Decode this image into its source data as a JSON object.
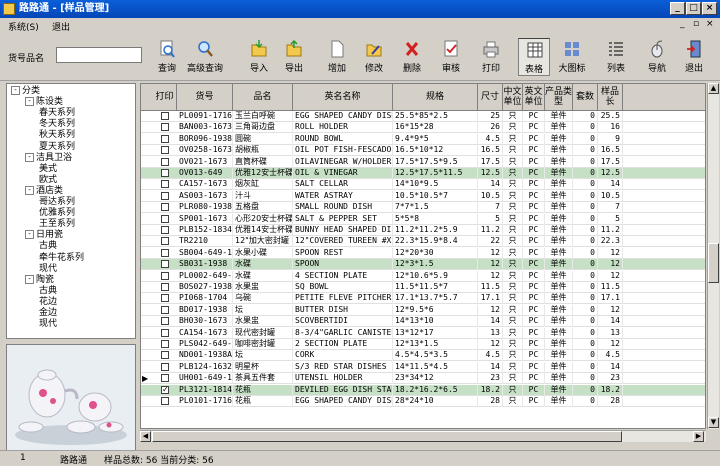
{
  "window": {
    "title": "路路通 - [样品管理]"
  },
  "menu": {
    "system": "系统(S)",
    "exit": "退出"
  },
  "search": {
    "label": "货号品名",
    "value": ""
  },
  "toolbar": [
    {
      "name": "query",
      "label": "查询",
      "icon": "search-icon"
    },
    {
      "name": "advanced-query",
      "label": "高级查询",
      "icon": "magnifier-icon"
    },
    {
      "name": "import",
      "label": "导入",
      "icon": "folder-in-icon"
    },
    {
      "name": "export",
      "label": "导出",
      "icon": "folder-out-icon"
    },
    {
      "name": "add",
      "label": "增加",
      "icon": "new-doc-icon"
    },
    {
      "name": "edit",
      "label": "修改",
      "icon": "folder-edit-icon"
    },
    {
      "name": "delete",
      "label": "删除",
      "icon": "x-icon"
    },
    {
      "name": "review",
      "label": "审核",
      "icon": "check-doc-icon"
    },
    {
      "name": "print",
      "label": "打印",
      "icon": "printer-icon"
    },
    {
      "name": "table",
      "label": "表格",
      "icon": "table-icon"
    },
    {
      "name": "large-icons",
      "label": "大图标",
      "icon": "large-icons-icon"
    },
    {
      "name": "list",
      "label": "列表",
      "icon": "list-icon"
    },
    {
      "name": "navigate",
      "label": "导航",
      "icon": "mouse-icon"
    },
    {
      "name": "exit",
      "label": "退出",
      "icon": "exit-door-icon"
    }
  ],
  "tree": [
    {
      "label": "分类",
      "level": 0,
      "box": "-"
    },
    {
      "label": "陈设类",
      "level": 1,
      "box": "-"
    },
    {
      "label": "春天系列",
      "level": 2
    },
    {
      "label": "冬天系列",
      "level": 2
    },
    {
      "label": "秋天系列",
      "level": 2
    },
    {
      "label": "夏天系列",
      "level": 2
    },
    {
      "label": "洁具卫浴",
      "level": 1,
      "box": "-"
    },
    {
      "label": "美式",
      "level": 2
    },
    {
      "label": "欧式",
      "level": 2
    },
    {
      "label": "酒店类",
      "level": 1,
      "box": "-"
    },
    {
      "label": "哥达系列",
      "level": 2
    },
    {
      "label": "优雅系列",
      "level": 2
    },
    {
      "label": "王至系列",
      "level": 2
    },
    {
      "label": "日用瓷",
      "level": 1,
      "box": "-"
    },
    {
      "label": "古典",
      "level": 2
    },
    {
      "label": "牵牛花系列",
      "level": 2
    },
    {
      "label": "现代",
      "level": 2
    },
    {
      "label": "陶瓷",
      "level": 1,
      "box": "-"
    },
    {
      "label": "古典",
      "level": 2
    },
    {
      "label": "花边",
      "level": 2
    },
    {
      "label": "金边",
      "level": 2
    },
    {
      "label": "现代",
      "level": 2
    }
  ],
  "columns": [
    "打印",
    "货号",
    "品名",
    "英名名称",
    "规格",
    "尺寸",
    "中文单位",
    "英文单位",
    "产品类型",
    "套数",
    "样品长"
  ],
  "rows": [
    {
      "print": false,
      "code": "PL0091-1716B",
      "name": "玉兰白呼碗",
      "en": "EGG SHAPED CANDY DISH-M",
      "spec": "25.5*85*2.5",
      "size": "25",
      "cu": "只",
      "eu": "PC",
      "type": "单件",
      "sets": "0",
      "len": "25.5",
      "hl": false
    },
    {
      "print": false,
      "code": "BAN003-1673",
      "name": "三角哥边盘",
      "en": "ROLL HOLDER",
      "spec": "16*15*28",
      "size": "26",
      "cu": "只",
      "eu": "PC",
      "type": "单件",
      "sets": "0",
      "len": "16",
      "hl": false
    },
    {
      "print": false,
      "code": "BOR096-1938",
      "name": "圆碗",
      "en": "ROUND BOWL",
      "spec": "9.4*9*5",
      "size": "4.5",
      "cu": "只",
      "eu": "PC",
      "type": "单件",
      "sets": "0",
      "len": "9",
      "hl": false
    },
    {
      "print": false,
      "code": "OV0258-1673",
      "name": "胡椒瓶",
      "en": "OIL POT FISH-FESCADO",
      "spec": "16.5*10*12",
      "size": "16.5",
      "cu": "只",
      "eu": "PC",
      "type": "单件",
      "sets": "0",
      "len": "16.5",
      "hl": false
    },
    {
      "print": false,
      "code": "OV021-1673",
      "name": "直筒杯碟",
      "en": "OILAVINEGAR W/HOLDER",
      "spec": "17.5*17.5*9.5",
      "size": "17.5",
      "cu": "只",
      "eu": "PC",
      "type": "单件",
      "sets": "0",
      "len": "17.5",
      "hl": false
    },
    {
      "print": false,
      "code": "OV013-649",
      "name": "优雅12安士杯碟",
      "en": "OIL & VINEGAR",
      "spec": "12.5*17.5*11.5",
      "size": "12.5",
      "cu": "只",
      "eu": "PC",
      "type": "单件",
      "sets": "0",
      "len": "12.5",
      "hl": true
    },
    {
      "print": false,
      "code": "CA157-1673",
      "name": "烟灰缸",
      "en": "SALT CELLAR",
      "spec": "14*10*9.5",
      "size": "14",
      "cu": "只",
      "eu": "PC",
      "type": "单件",
      "sets": "0",
      "len": "14",
      "hl": false
    },
    {
      "print": false,
      "code": "AS003-1673",
      "name": "汁斗",
      "en": "WATER ASTRAY",
      "spec": "10.5*10.5*7",
      "size": "10.5",
      "cu": "只",
      "eu": "PC",
      "type": "单件",
      "sets": "0",
      "len": "10.5",
      "hl": false
    },
    {
      "print": false,
      "code": "PLR080-1938D",
      "name": "五格盘",
      "en": "SMALL ROUND DISH",
      "spec": "7*7*1.5",
      "size": "7",
      "cu": "只",
      "eu": "PC",
      "type": "单件",
      "sets": "0",
      "len": "7",
      "hl": false
    },
    {
      "print": false,
      "code": "SP001-1673",
      "name": "心形20安士杯碟",
      "en": "SALT & PEPPER SET",
      "spec": "5*5*8",
      "size": "5",
      "cu": "只",
      "eu": "PC",
      "type": "单件",
      "sets": "0",
      "len": "5",
      "hl": false
    },
    {
      "print": false,
      "code": "PLB152-1834",
      "name": "优雅14安士杯碟",
      "en": "BUNNY HEAD SHAPED DISH",
      "spec": "11.2*11.2*5.9",
      "size": "11.2",
      "cu": "只",
      "eu": "PC",
      "type": "单件",
      "sets": "0",
      "len": "11.2",
      "hl": false
    },
    {
      "print": false,
      "code": "TR2210",
      "name": "12\"加大密封罐",
      "en": "12\"COVERED TUREEN #XL",
      "spec": "22.3*15.9*8.4",
      "size": "22",
      "cu": "只",
      "eu": "PC",
      "type": "单件",
      "sets": "0",
      "len": "22.3",
      "hl": false
    },
    {
      "print": false,
      "code": "SB004-649-1",
      "name": "水果小碟",
      "en": "SPOON REST",
      "spec": "12*20*30",
      "size": "12",
      "cu": "只",
      "eu": "PC",
      "type": "单件",
      "sets": "0",
      "len": "12",
      "hl": false
    },
    {
      "print": false,
      "code": "SB031-1938",
      "name": "水碟",
      "en": "SPOON",
      "spec": "12*3*1.5",
      "size": "12",
      "cu": "只",
      "eu": "PC",
      "type": "单件",
      "sets": "0",
      "len": "12",
      "hl": true
    },
    {
      "print": false,
      "code": "PL0002-649-1",
      "name": "水碟",
      "en": "4 SECTION PLATE",
      "spec": "12*10.6*5.9",
      "size": "12",
      "cu": "只",
      "eu": "PC",
      "type": "单件",
      "sets": "0",
      "len": "12",
      "hl": false
    },
    {
      "print": false,
      "code": "BOS027-1938A",
      "name": "水果盅",
      "en": "SQ BOWL",
      "spec": "11.5*11.5*7",
      "size": "11.5",
      "cu": "只",
      "eu": "PC",
      "type": "单件",
      "sets": "0",
      "len": "11.5",
      "hl": false
    },
    {
      "print": false,
      "code": "PI068-1704",
      "name": "乌碗",
      "en": "PETITE FLEVE PITCHER",
      "spec": "17.1*13.7*5.7",
      "size": "17.1",
      "cu": "只",
      "eu": "PC",
      "type": "单件",
      "sets": "0",
      "len": "17.1",
      "hl": false
    },
    {
      "print": false,
      "code": "BD017-1938",
      "name": "坛",
      "en": "BUTTER DISH",
      "spec": "12*9.5*6",
      "size": "12",
      "cu": "只",
      "eu": "PC",
      "type": "单件",
      "sets": "0",
      "len": "12",
      "hl": false
    },
    {
      "print": false,
      "code": "BH030-1673",
      "name": "水果盅",
      "en": "SCOVBERTIDI",
      "spec": "14*13*10",
      "size": "14",
      "cu": "只",
      "eu": "PC",
      "type": "单件",
      "sets": "0",
      "len": "14",
      "hl": false
    },
    {
      "print": false,
      "code": "CA154-1673",
      "name": "现代密封罐",
      "en": "8-3/4\"GARLIC CANISTER",
      "spec": "13*12*17",
      "size": "13",
      "cu": "只",
      "eu": "PC",
      "type": "单件",
      "sets": "0",
      "len": "13",
      "hl": false
    },
    {
      "print": false,
      "code": "PLS042-649-1",
      "name": "咖啡密封罐",
      "en": "2 SECTION PLATE",
      "spec": "12*13*1.5",
      "size": "12",
      "cu": "只",
      "eu": "PC",
      "type": "单件",
      "sets": "0",
      "len": "12",
      "hl": false
    },
    {
      "print": false,
      "code": "ND001-1938A",
      "name": "坛",
      "en": "CORK",
      "spec": "4.5*4.5*3.5",
      "size": "4.5",
      "cu": "只",
      "eu": "PC",
      "type": "单件",
      "sets": "0",
      "len": "4.5",
      "hl": false
    },
    {
      "print": false,
      "code": "PLB124-1632",
      "name": "明星杯",
      "en": "S/3 RED STAR DISHES",
      "spec": "14*11.5*4.5",
      "size": "14",
      "cu": "只",
      "eu": "PC",
      "type": "单件",
      "sets": "0",
      "len": "14",
      "hl": false
    },
    {
      "print": false,
      "code": "UH001-649-1",
      "name": "茶具五件套",
      "en": "UTENSIL HOLDER",
      "spec": "23*34*12",
      "size": "23",
      "cu": "只",
      "eu": "PC",
      "type": "单件",
      "sets": "0",
      "len": "23",
      "hl": false,
      "current": true
    },
    {
      "print": true,
      "code": "PL3121-1814",
      "name": "花瓶",
      "en": "DEVILED EGG DISH STAND",
      "spec": "18.2*16.2*6.5",
      "size": "18.2",
      "cu": "只",
      "eu": "PC",
      "type": "单件",
      "sets": "0",
      "len": "18.2",
      "hl": true
    },
    {
      "print": false,
      "code": "PL0101-1716A",
      "name": "花瓶",
      "en": "EGG SHAPED CANDY DISH-L",
      "spec": "28*24*10",
      "size": "28",
      "cu": "只",
      "eu": "PC",
      "type": "单件",
      "sets": "0",
      "len": "28",
      "hl": false
    }
  ],
  "status": {
    "page": "1",
    "app": "路路通",
    "total": "样品总数: 56 当前分类: 56"
  },
  "colors": {
    "title": "#0a5fd8",
    "highlight": "#c6e0c6",
    "window": "#d4d0c8"
  }
}
